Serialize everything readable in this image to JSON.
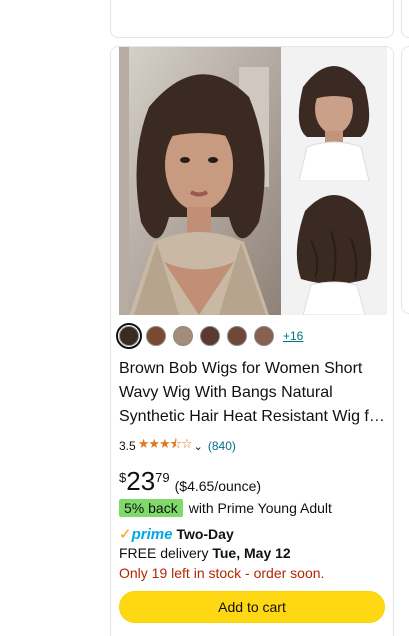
{
  "product": {
    "swatches": [
      {
        "color": "#3a2a22",
        "selected": true
      },
      {
        "color": "#7a4a30",
        "selected": false
      },
      {
        "color": "#a48c7a",
        "selected": false
      },
      {
        "color": "#5a3a2e",
        "selected": false
      },
      {
        "color": "#6e4a36",
        "selected": false
      },
      {
        "color": "#8a6050",
        "selected": false
      }
    ],
    "more_colors": "+16",
    "title": "Brown Bob Wigs for Women Short Wavy Wig With Bangs Natural Synthetic Hair Heat Resistant Wig for Daily Party Use",
    "rating_value": "3.5",
    "rating_stars": 3.5,
    "rating_count": "(840)",
    "price_symbol": "$",
    "price_whole": "23",
    "price_fraction": "79",
    "unit_price": "($4.65/ounce)",
    "back_badge": "5% back",
    "back_text": "with Prime Young Adult",
    "prime_label": "prime",
    "prime_speed": "Two-Day",
    "delivery_prefix": "FREE delivery",
    "delivery_date": "Tue, May 12",
    "stock_text": "Only 19 left in stock - order soon.",
    "cart_label": "Add to cart"
  },
  "colors": {
    "link": "#007185",
    "star": "#de7921",
    "stock": "#b12704",
    "cart_button": "#ffd814",
    "back_badge": "#7fda69",
    "prime": "#00a8e1"
  }
}
